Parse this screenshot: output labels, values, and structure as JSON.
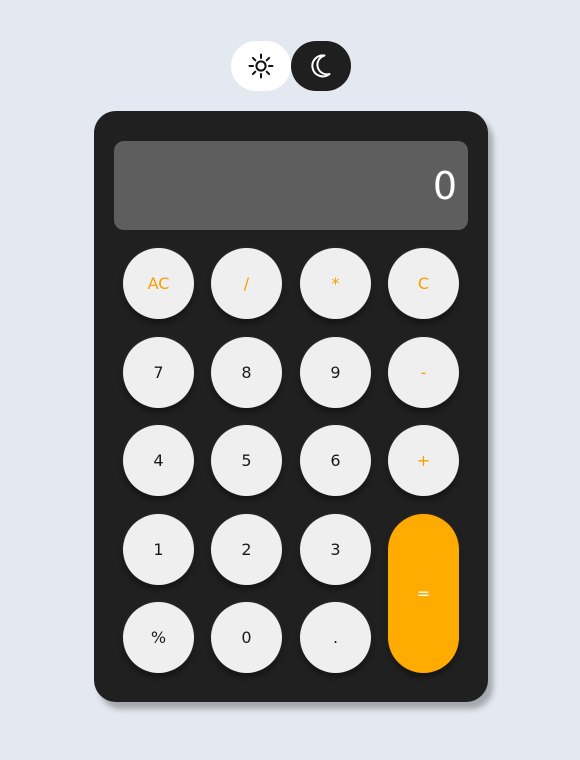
{
  "theme_toggle": {
    "light_icon": "sun-icon",
    "dark_icon": "moon-icon"
  },
  "calculator": {
    "display_value": "0",
    "keys": {
      "ac": "AC",
      "divide": "/",
      "multiply": "*",
      "clear": "C",
      "seven": "7",
      "eight": "8",
      "nine": "9",
      "minus": "-",
      "four": "4",
      "five": "5",
      "six": "6",
      "plus": "+",
      "one": "1",
      "two": "2",
      "three": "3",
      "equals": "=",
      "percent": "%",
      "zero": "0",
      "decimal": "."
    }
  },
  "colors": {
    "page_background": "#e4e8f0",
    "calculator_body": "#202020",
    "display_background": "#5e5e5e",
    "key_background": "#efefef",
    "operator_text": "#f7a000",
    "equals_background": "#ffab00"
  }
}
